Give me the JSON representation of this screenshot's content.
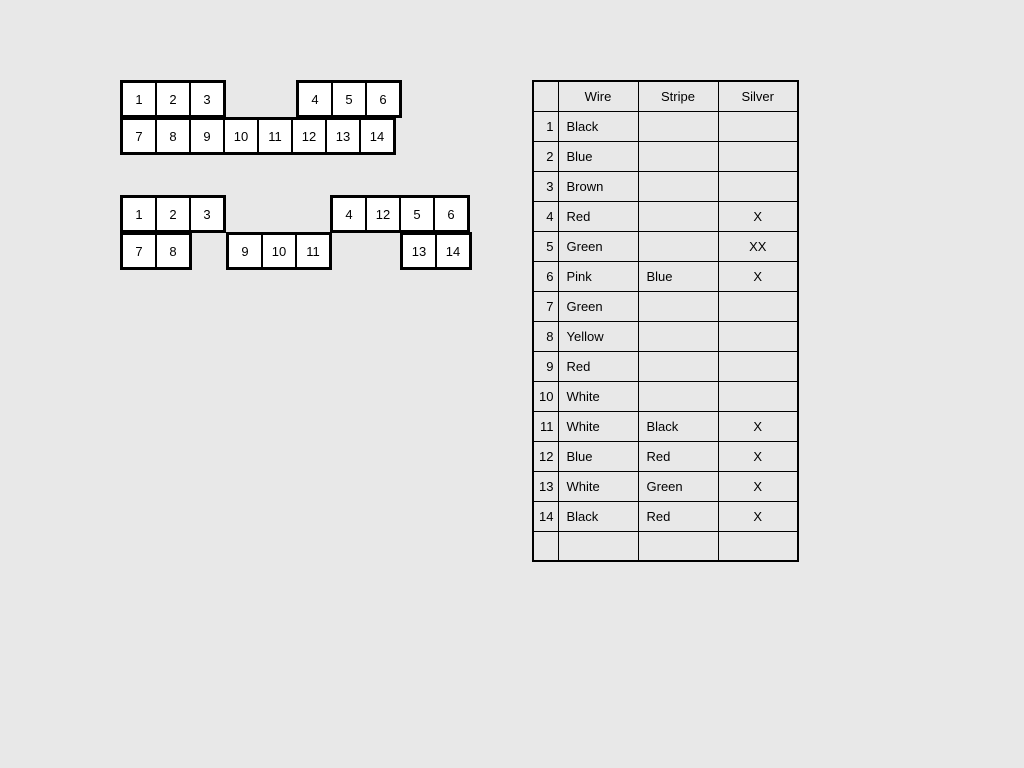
{
  "connectors": {
    "conn1": {
      "top": [
        "1",
        "2",
        "3",
        "",
        "",
        "4",
        "5",
        "6"
      ],
      "bottom": [
        "7",
        "8",
        "9",
        "10",
        "11",
        "12",
        "13",
        "14"
      ],
      "top_groups": [
        {
          "cells": [
            "1",
            "2",
            "3"
          ],
          "gap": true,
          "cells2": [
            "4",
            "5",
            "6"
          ]
        }
      ]
    },
    "conn2": {
      "top": [
        "1",
        "2",
        "3",
        "",
        "",
        "",
        "4",
        "12",
        "5",
        "6"
      ],
      "bottom": [
        "7",
        "8",
        "",
        "9",
        "10",
        "11",
        "",
        "",
        "13",
        "14"
      ]
    }
  },
  "table": {
    "headers": [
      "",
      "Wire",
      "Stripe",
      "Silver"
    ],
    "rows": [
      {
        "num": "1",
        "wire": "Black",
        "stripe": "",
        "silver": ""
      },
      {
        "num": "2",
        "wire": "Blue",
        "stripe": "",
        "silver": ""
      },
      {
        "num": "3",
        "wire": "Brown",
        "stripe": "",
        "silver": ""
      },
      {
        "num": "4",
        "wire": "Red",
        "stripe": "",
        "silver": "X"
      },
      {
        "num": "5",
        "wire": "Green",
        "stripe": "",
        "silver": "XX"
      },
      {
        "num": "6",
        "wire": "Pink",
        "stripe": "Blue",
        "silver": "X"
      },
      {
        "num": "7",
        "wire": "Green",
        "stripe": "",
        "silver": ""
      },
      {
        "num": "8",
        "wire": "Yellow",
        "stripe": "",
        "silver": ""
      },
      {
        "num": "9",
        "wire": "Red",
        "stripe": "",
        "silver": ""
      },
      {
        "num": "10",
        "wire": "White",
        "stripe": "",
        "silver": ""
      },
      {
        "num": "11",
        "wire": "White",
        "stripe": "Black",
        "silver": "X"
      },
      {
        "num": "12",
        "wire": "Blue",
        "stripe": "Red",
        "silver": "X"
      },
      {
        "num": "13",
        "wire": "White",
        "stripe": "Green",
        "silver": "X"
      },
      {
        "num": "14",
        "wire": "Black",
        "stripe": "Red",
        "silver": "X"
      },
      {
        "num": "",
        "wire": "",
        "stripe": "",
        "silver": ""
      }
    ]
  }
}
